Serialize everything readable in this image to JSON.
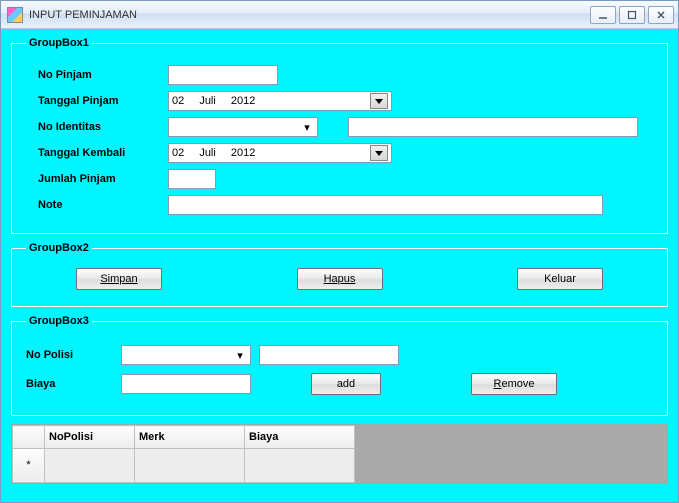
{
  "window": {
    "title": "INPUT PEMINJAMAN"
  },
  "group1": {
    "legend": "GroupBox1",
    "labels": {
      "no_pinjam": "No Pinjam",
      "tanggal_pinjam": "Tanggal Pinjam",
      "no_identitas": "No Identitas",
      "tanggal_kembali": "Tanggal Kembali",
      "jumlah_pinjam": "Jumlah Pinjam",
      "note": "Note"
    },
    "values": {
      "no_pinjam": "",
      "tgl_pinjam": {
        "day": "02",
        "month": "Juli",
        "year": "2012"
      },
      "no_identitas": "",
      "identitas_detail": "",
      "tgl_kembali": {
        "day": "02",
        "month": "Juli",
        "year": "2012"
      },
      "jumlah_pinjam": "",
      "note": ""
    }
  },
  "group2": {
    "legend": "GroupBox2",
    "buttons": {
      "simpan": "Simpan",
      "hapus": "Hapus",
      "keluar": "Keluar"
    }
  },
  "group3": {
    "legend": "GroupBox3",
    "labels": {
      "no_polisi": "No Polisi",
      "biaya": "Biaya"
    },
    "values": {
      "no_polisi": "",
      "no_polisi_detail": "",
      "biaya": ""
    },
    "buttons": {
      "add": "add",
      "remove": "Remove"
    }
  },
  "grid": {
    "columns": [
      "NoPolisi",
      "Merk",
      "Biaya"
    ],
    "new_row_marker": "*"
  }
}
